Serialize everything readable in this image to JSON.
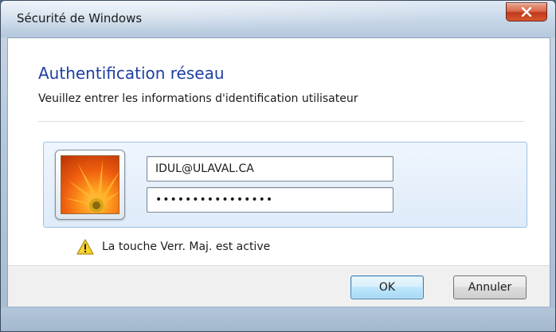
{
  "window": {
    "title": "Sécurité de Windows"
  },
  "dialog": {
    "heading": "Authentification réseau",
    "subheading": "Veuillez entrer les informations d'identification utilisateur"
  },
  "credentials": {
    "username_value": "IDUL@ULAVAL.CA",
    "password_masked": "••••••••••••••••"
  },
  "warning": {
    "text": "La touche Verr. Maj. est active",
    "icon": "warning-icon"
  },
  "buttons": {
    "ok_label": "OK",
    "cancel_label": "Annuler"
  },
  "colors": {
    "heading": "#1e3fa0",
    "close_button": "#c0391b",
    "tile_border": "#9dc0e6"
  }
}
